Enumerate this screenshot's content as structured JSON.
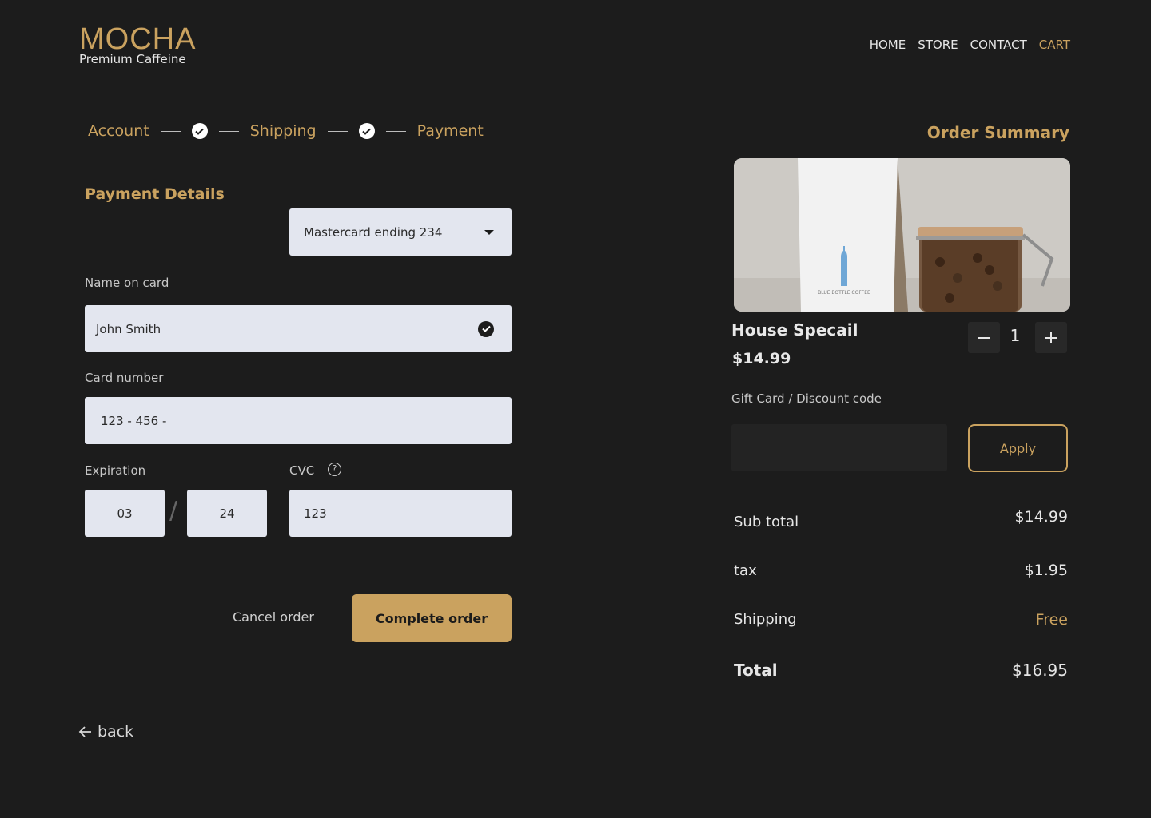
{
  "brand": {
    "name": "MOCHA",
    "tagline": "Premium Caffeine"
  },
  "nav": [
    "HOME",
    "STORE",
    "CONTACT",
    "CART"
  ],
  "nav_active": "CART",
  "stepper": {
    "steps": [
      "Account",
      "Shipping",
      "Payment"
    ]
  },
  "payment": {
    "title": "Payment Details",
    "card_select": "Mastercard ending 234",
    "name_label": "Name on card",
    "name_value": "John Smith",
    "card_label": "Card number",
    "card_value": "123 - 456 -",
    "expiration_label": "Expiration",
    "exp_month": "03",
    "exp_year": "24",
    "cvc_label": "CVC",
    "cvc_value": "123",
    "cancel_label": "Cancel order",
    "complete_label": "Complete order"
  },
  "back_label": "back",
  "summary": {
    "title": "Order Summary",
    "product_name": "House Specail",
    "product_price": "$14.99",
    "quantity": "1",
    "product_image_text": "BLUE BOTTLE COFFEE",
    "discount_label": "Gift Card / Discount code",
    "discount_placeholder": "",
    "apply_label": "Apply",
    "rows": {
      "subtotal_label": "Sub total",
      "subtotal_value": "$14.99",
      "tax_label": "tax",
      "tax_value": "$1.95",
      "shipping_label": "Shipping",
      "shipping_value": "Free",
      "total_label": "Total",
      "total_value": "$16.95"
    }
  },
  "colors": {
    "background": "#1c1c1c",
    "accent": "#caa25f",
    "field": "#e3e6ef"
  }
}
